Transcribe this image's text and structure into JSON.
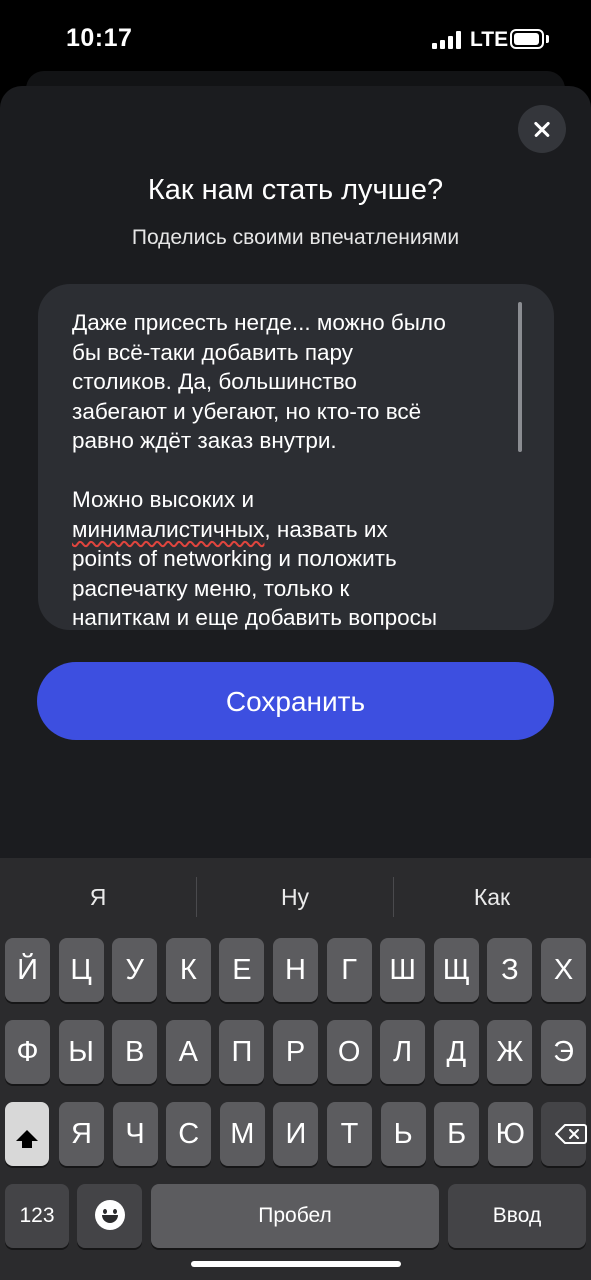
{
  "status_bar": {
    "time": "10:17",
    "network": "LTE"
  },
  "dialog": {
    "title": "Как нам стать лучше?",
    "subtitle": "Поделись своими впечатлениями",
    "feedback": {
      "text_before": "Даже присесть негде... можно было\nбы всё-таки добавить пару\nстоликов. Да, большинство\nзабегают и убегают, но кто-то всё\nравно ждёт заказ внутри.\n\nМожно высоких и\n",
      "misspelled_word": "минималистичных",
      "text_after": ", назвать их\npoints of networking и положить\nраспечатку меню, только к\nнапиткам и еще добавить вопросы"
    },
    "save_label": "Сохранить"
  },
  "keyboard": {
    "suggestions": [
      "Я",
      "Ну",
      "Как"
    ],
    "row1": [
      "Й",
      "Ц",
      "У",
      "К",
      "Е",
      "Н",
      "Г",
      "Ш",
      "Щ",
      "З",
      "Х"
    ],
    "row2": [
      "Ф",
      "Ы",
      "В",
      "А",
      "П",
      "Р",
      "О",
      "Л",
      "Д",
      "Ж",
      "Э"
    ],
    "row3": [
      "Я",
      "Ч",
      "С",
      "М",
      "И",
      "Т",
      "Ь",
      "Б",
      "Ю"
    ],
    "numbers_label": "123",
    "space_label": "Пробел",
    "return_label": "Ввод"
  }
}
